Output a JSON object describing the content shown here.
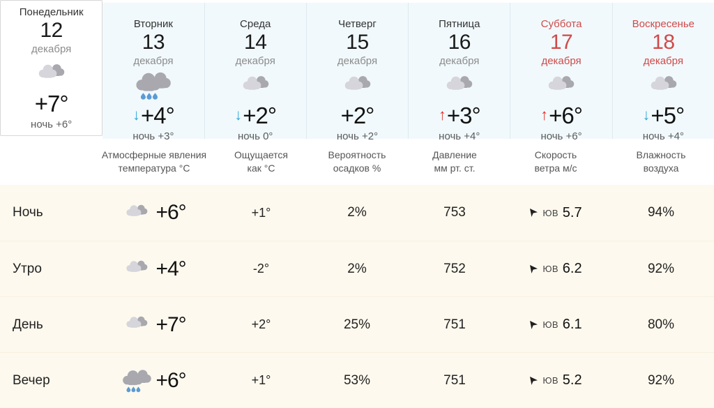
{
  "days": [
    {
      "weekday": "Понедельник",
      "daynum": "12",
      "month": "декабря",
      "icon": "cloudy-icon",
      "trend": "none",
      "trend_glyph": "",
      "temp": "+7°",
      "night": "ночь +6°",
      "is_today": true,
      "is_weekend": false
    },
    {
      "weekday": "Вторник",
      "daynum": "13",
      "month": "декабря",
      "icon": "rain-cloud-icon",
      "trend": "down",
      "trend_glyph": "↓",
      "temp": "+4°",
      "night": "ночь +3°",
      "is_today": false,
      "is_weekend": false
    },
    {
      "weekday": "Среда",
      "daynum": "14",
      "month": "декабря",
      "icon": "cloudy-icon",
      "trend": "down",
      "trend_glyph": "↓",
      "temp": "+2°",
      "night": "ночь 0°",
      "is_today": false,
      "is_weekend": false
    },
    {
      "weekday": "Четверг",
      "daynum": "15",
      "month": "декабря",
      "icon": "cloudy-icon",
      "trend": "none",
      "trend_glyph": "",
      "temp": "+2°",
      "night": "ночь +2°",
      "is_today": false,
      "is_weekend": false
    },
    {
      "weekday": "Пятница",
      "daynum": "16",
      "month": "декабря",
      "icon": "cloudy-icon",
      "trend": "up",
      "trend_glyph": "↑",
      "temp": "+3°",
      "night": "ночь +4°",
      "is_today": false,
      "is_weekend": false
    },
    {
      "weekday": "Суббота",
      "daynum": "17",
      "month": "декабря",
      "icon": "cloudy-icon",
      "trend": "up",
      "trend_glyph": "↑",
      "temp": "+6°",
      "night": "ночь +6°",
      "is_today": false,
      "is_weekend": true
    },
    {
      "weekday": "Воскресенье",
      "daynum": "18",
      "month": "декабря",
      "icon": "cloudy-icon",
      "trend": "down",
      "trend_glyph": "↓",
      "temp": "+5°",
      "night": "ночь +4°",
      "is_today": false,
      "is_weekend": true
    }
  ],
  "table": {
    "headers": {
      "period": "",
      "phenomena_line1": "Атмосферные явления",
      "phenomena_line2": "температура °C",
      "feels_line1": "Ощущается",
      "feels_line2": "как °C",
      "precip_line1": "Вероятность",
      "precip_line2": "осадков %",
      "pressure_line1": "Давление",
      "pressure_line2": "мм рт. ст.",
      "wind_line1": "Скорость",
      "wind_line2": "ветра м/с",
      "humidity_line1": "Влажность",
      "humidity_line2": "воздуха"
    },
    "rows": [
      {
        "period": "Ночь",
        "icon": "cloudy-icon",
        "temp": "+6°",
        "feels": "+1°",
        "precip": "2%",
        "pressure": "753",
        "wind_arrow": "wind-direction-arrow-icon",
        "wind_dir": "ЮВ",
        "wind_speed": "5.7",
        "humidity": "94%"
      },
      {
        "period": "Утро",
        "icon": "cloudy-icon",
        "temp": "+4°",
        "feels": "-2°",
        "precip": "2%",
        "pressure": "752",
        "wind_arrow": "wind-direction-arrow-icon",
        "wind_dir": "ЮВ",
        "wind_speed": "6.2",
        "humidity": "92%"
      },
      {
        "period": "День",
        "icon": "cloudy-icon",
        "temp": "+7°",
        "feels": "+2°",
        "precip": "25%",
        "pressure": "751",
        "wind_arrow": "wind-direction-arrow-icon",
        "wind_dir": "ЮВ",
        "wind_speed": "6.1",
        "humidity": "80%"
      },
      {
        "period": "Вечер",
        "icon": "rain-cloud-icon",
        "temp": "+6°",
        "feels": "+1°",
        "precip": "53%",
        "pressure": "751",
        "wind_arrow": "wind-direction-arrow-icon",
        "wind_dir": "ЮВ",
        "wind_speed": "5.2",
        "humidity": "92%"
      }
    ]
  },
  "colors": {
    "today_card_bg": "#ffffff",
    "day_card_bg": "#f1f9fc",
    "table_row_bg": "#fdf9ee",
    "weekend_text": "#d04a4a",
    "trend_down": "#2ea7d8",
    "trend_up": "#e0352b",
    "cloud_light": "#d5d5db",
    "cloud_dark": "#a8a8ae",
    "raindrop": "#5b9bd5"
  }
}
